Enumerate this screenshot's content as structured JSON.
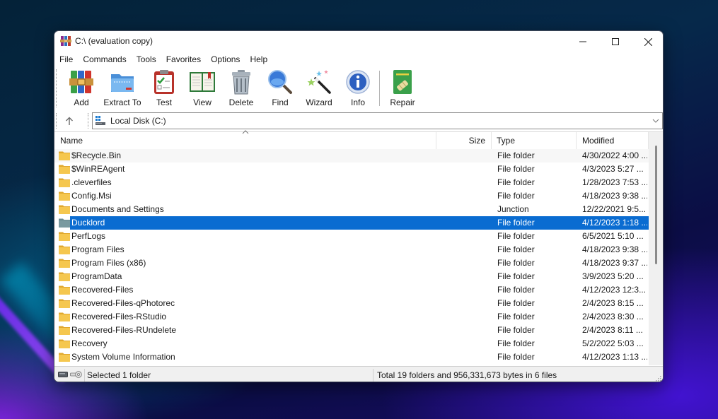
{
  "window": {
    "title": "C:\\ (evaluation copy)",
    "controls": {
      "minimize": "minimize",
      "maximize": "maximize",
      "close": "close"
    }
  },
  "menu": [
    "File",
    "Commands",
    "Tools",
    "Favorites",
    "Options",
    "Help"
  ],
  "toolbar": {
    "buttons": [
      {
        "id": "add",
        "label": "Add",
        "icon": "archive-books-icon"
      },
      {
        "id": "extract",
        "label": "Extract To",
        "icon": "blue-folder-icon"
      },
      {
        "id": "test",
        "label": "Test",
        "icon": "clipboard-check-icon"
      },
      {
        "id": "view",
        "label": "View",
        "icon": "open-book-icon"
      },
      {
        "id": "delete",
        "label": "Delete",
        "icon": "trash-can-icon"
      },
      {
        "id": "find",
        "label": "Find",
        "icon": "magnifier-icon"
      },
      {
        "id": "wizard",
        "label": "Wizard",
        "icon": "magic-wand-icon"
      },
      {
        "id": "info",
        "label": "Info",
        "icon": "info-icon"
      },
      {
        "id": "repair",
        "label": "Repair",
        "icon": "repair-kit-icon"
      }
    ]
  },
  "address": {
    "value": "Local Disk (C:)",
    "icon": "drive-icon"
  },
  "list": {
    "columns": {
      "name": "Name",
      "size": "Size",
      "type": "Type",
      "modified": "Modified"
    },
    "sort_column": "name",
    "rows": [
      {
        "name": "$Recycle.Bin",
        "size": "",
        "type": "File folder",
        "modified": "4/30/2022 4:00 ..."
      },
      {
        "name": "$WinREAgent",
        "size": "",
        "type": "File folder",
        "modified": "4/3/2023 5:27 ..."
      },
      {
        "name": ".cleverfiles",
        "size": "",
        "type": "File folder",
        "modified": "1/28/2023 7:53 ..."
      },
      {
        "name": "Config.Msi",
        "size": "",
        "type": "File folder",
        "modified": "4/18/2023 9:38 ..."
      },
      {
        "name": "Documents and Settings",
        "size": "",
        "type": "Junction",
        "modified": "12/22/2021 9:5..."
      },
      {
        "name": "Ducklord",
        "size": "",
        "type": "File folder",
        "modified": "4/12/2023 1:18 ...",
        "selected": true
      },
      {
        "name": "PerfLogs",
        "size": "",
        "type": "File folder",
        "modified": "6/5/2021 5:10 ..."
      },
      {
        "name": "Program Files",
        "size": "",
        "type": "File folder",
        "modified": "4/18/2023 9:38 ..."
      },
      {
        "name": "Program Files (x86)",
        "size": "",
        "type": "File folder",
        "modified": "4/18/2023 9:37 ..."
      },
      {
        "name": "ProgramData",
        "size": "",
        "type": "File folder",
        "modified": "3/9/2023 5:20 ..."
      },
      {
        "name": "Recovered-Files",
        "size": "",
        "type": "File folder",
        "modified": "4/12/2023 12:3..."
      },
      {
        "name": "Recovered-Files-qPhotorec",
        "size": "",
        "type": "File folder",
        "modified": "2/4/2023 8:15 ..."
      },
      {
        "name": "Recovered-Files-RStudio",
        "size": "",
        "type": "File folder",
        "modified": "2/4/2023 8:30 ..."
      },
      {
        "name": "Recovered-Files-RUndelete",
        "size": "",
        "type": "File folder",
        "modified": "2/4/2023 8:11 ..."
      },
      {
        "name": "Recovery",
        "size": "",
        "type": "File folder",
        "modified": "5/2/2022 5:03 ..."
      },
      {
        "name": "System Volume Information",
        "size": "",
        "type": "File folder",
        "modified": "4/12/2023 1:13 ..."
      }
    ],
    "scroll_position": 0.0,
    "scroll_visible_fraction": 0.58
  },
  "status": {
    "left": "Selected 1 folder",
    "right": "Total 19 folders and 956,331,673 bytes in 6 files"
  },
  "colors": {
    "selection": "#0a6cd1",
    "folder": "#f5c74f",
    "selected_folder": "#7a9aa0"
  }
}
